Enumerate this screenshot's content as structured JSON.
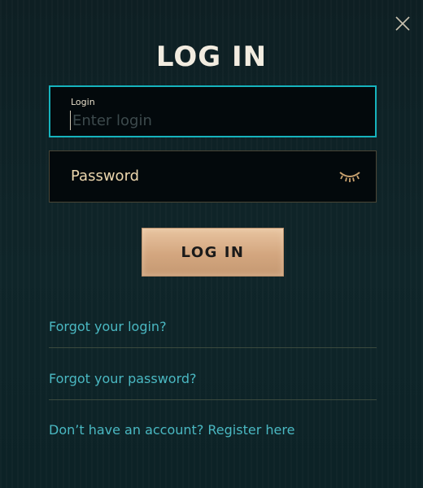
{
  "dialog": {
    "title": "LOG IN",
    "close_icon": "close-icon"
  },
  "login_field": {
    "label": "Login",
    "placeholder": "Enter login",
    "value": ""
  },
  "password_field": {
    "label": "Password",
    "toggle_icon": "eye-closed-icon"
  },
  "submit": {
    "label": "LOG IN"
  },
  "links": {
    "forgot_login": "Forgot your login?",
    "forgot_password": "Forgot your password?",
    "register": "Don’t have an account? Register here"
  },
  "colors": {
    "accent_cyan": "#16b3bd",
    "link": "#4ab8c2",
    "gold": "#d3a67f",
    "field_bg": "#03090c"
  }
}
